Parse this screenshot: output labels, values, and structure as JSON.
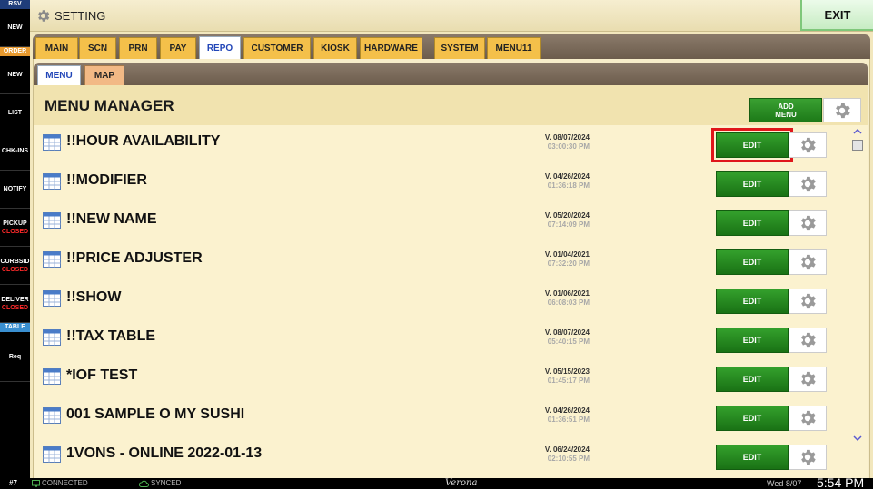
{
  "sidebar": {
    "items": [
      {
        "type": "section",
        "label": "RSV",
        "bg": "#1f3d7a"
      },
      {
        "type": "button",
        "label": "NEW"
      },
      {
        "type": "section",
        "label": "ORDER",
        "bg": "#e89a2f"
      },
      {
        "type": "button",
        "label": "NEW"
      },
      {
        "type": "button",
        "label": "LIST"
      },
      {
        "type": "button",
        "label": "CHK-INS"
      },
      {
        "type": "button",
        "label": "NOTIFY"
      },
      {
        "type": "button",
        "label": "PICKUP",
        "sub": "CLOSED"
      },
      {
        "type": "button",
        "label": "CURBSID",
        "sub": "CLOSED"
      },
      {
        "type": "button",
        "label": "DELIVER",
        "sub": "CLOSED"
      },
      {
        "type": "section",
        "label": "TABLE",
        "bg": "#3a8fd0"
      },
      {
        "type": "button",
        "label": "Req"
      }
    ]
  },
  "header": {
    "title": "SETTING",
    "exit_label": "EXIT"
  },
  "tabs": [
    {
      "label": "MAIN"
    },
    {
      "label": "SCN"
    },
    {
      "label": "PRN"
    },
    {
      "label": "PAY"
    },
    {
      "label": "REPO",
      "active": true
    },
    {
      "label": "CUSTOMER"
    },
    {
      "label": "KIOSK"
    },
    {
      "label": "HARDWARE"
    },
    {
      "label": "SYSTEM"
    },
    {
      "label": "MENU11"
    }
  ],
  "subtabs": [
    {
      "label": "MENU",
      "active": true
    },
    {
      "label": "MAP"
    }
  ],
  "menu_manager": {
    "title": "MENU MANAGER",
    "add_menu_line1": "ADD",
    "add_menu_line2": "MENU",
    "edit_label": "EDIT",
    "rows": [
      {
        "name": "!!HOUR AVAILABILITY",
        "version": "V. 08/07/2024",
        "time": "03:00:30 PM",
        "highlight": true
      },
      {
        "name": "!!MODIFIER",
        "version": "V. 04/26/2024",
        "time": "01:36:18 PM"
      },
      {
        "name": "!!NEW NAME",
        "version": "V. 05/20/2024",
        "time": "07:14:09 PM"
      },
      {
        "name": "!!PRICE ADJUSTER",
        "version": "V. 01/04/2021",
        "time": "07:32:20 PM"
      },
      {
        "name": "!!SHOW",
        "version": "V. 01/06/2021",
        "time": "06:08:03 PM"
      },
      {
        "name": "!!TAX TABLE",
        "version": "V. 08/07/2024",
        "time": "05:40:15 PM"
      },
      {
        "name": "*IOF TEST",
        "version": "V. 05/15/2023",
        "time": "01:45:17 PM"
      },
      {
        "name": "001 SAMPLE O MY SUSHI",
        "version": "V. 04/26/2024",
        "time": "01:36:51 PM"
      },
      {
        "name": "1VONS - ONLINE 2022-01-13",
        "version": "V. 06/24/2024",
        "time": "02:10:55 PM"
      }
    ]
  },
  "status": {
    "station": "#7",
    "connected": "CONNECTED",
    "synced": "SYNCED",
    "store": "Verona",
    "date": "Wed 8/07",
    "time": "5:54 PM"
  },
  "colors": {
    "accent_green": "#1d7a18",
    "highlight_red": "#e0161b",
    "active_tab_text": "#2246b8"
  }
}
